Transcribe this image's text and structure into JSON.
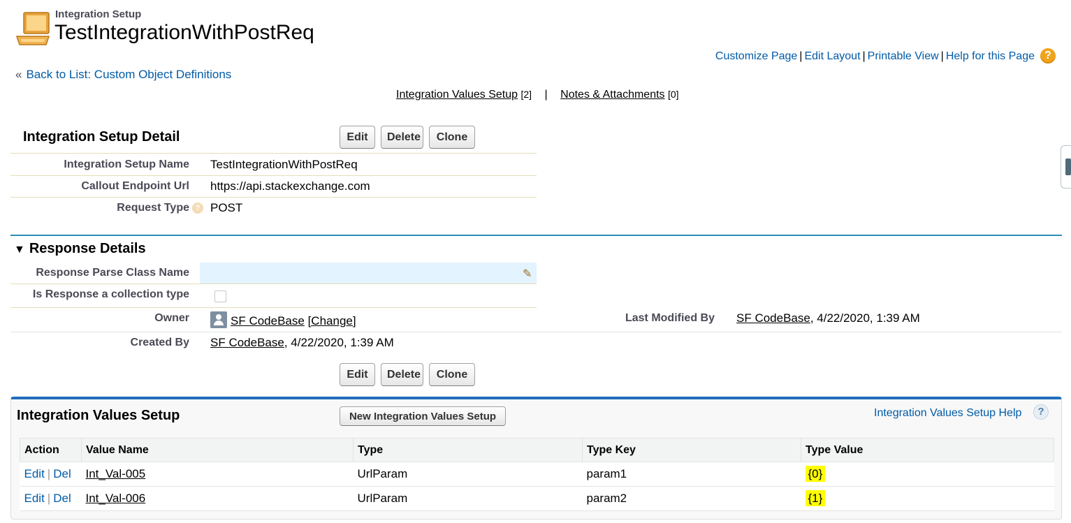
{
  "header": {
    "object_label": "Integration Setup",
    "record_title": "TestIntegrationWithPostReq",
    "links": [
      "Customize Page",
      "Edit Layout",
      "Printable View",
      "Help for this Page"
    ],
    "help_glyph": "?",
    "back_link": "Back to List: Custom Object Definitions",
    "back_glyph": "«"
  },
  "related_links": [
    {
      "label": "Integration Values Setup",
      "count": "[2]"
    },
    {
      "label": "Notes & Attachments",
      "count": "[0]"
    }
  ],
  "detail": {
    "title": "Integration Setup Detail",
    "buttons": [
      "Edit",
      "Delete",
      "Clone"
    ],
    "fields": [
      {
        "label": "Integration Setup Name",
        "value": "TestIntegrationWithPostReq"
      },
      {
        "label": "Callout Endpoint Url",
        "value": "https://api.stackexchange.com"
      },
      {
        "label": "Request Type",
        "value": "POST"
      }
    ]
  },
  "response": {
    "title": "Response Details",
    "fields": [
      {
        "label": "Response Parse Class Name",
        "value": ""
      },
      {
        "label": "Is Response a collection type",
        "checked": false
      }
    ],
    "owner": {
      "label": "Owner",
      "name": "SF CodeBase",
      "change": "[Change]"
    },
    "last_modified": {
      "label": "Last Modified By",
      "name": "SF CodeBase",
      "date": ", 4/22/2020, 1:39 AM"
    },
    "created": {
      "label": "Created By",
      "name": "SF CodeBase",
      "date": ", 4/22/2020, 1:39 AM"
    }
  },
  "related_list": {
    "title": "Integration Values Setup",
    "new_button": "New Integration Values Setup",
    "help_link": "Integration Values Setup Help",
    "help_glyph": "?",
    "columns": [
      "Action",
      "Value Name",
      "Type",
      "Type Key",
      "Type Value"
    ],
    "rows": [
      {
        "edit": "Edit",
        "del": "Del",
        "name": "Int_Val-005",
        "type": "UrlParam",
        "key": "param1",
        "value": "{0}"
      },
      {
        "edit": "Edit",
        "del": "Del",
        "name": "Int_Val-006",
        "type": "UrlParam",
        "key": "param2",
        "value": "{1}"
      }
    ]
  },
  "colors": {
    "link": "#015ba7",
    "section_bar": "#2b8fb6",
    "related_list_bar": "#236fbd",
    "highlight": "#ffff00"
  }
}
